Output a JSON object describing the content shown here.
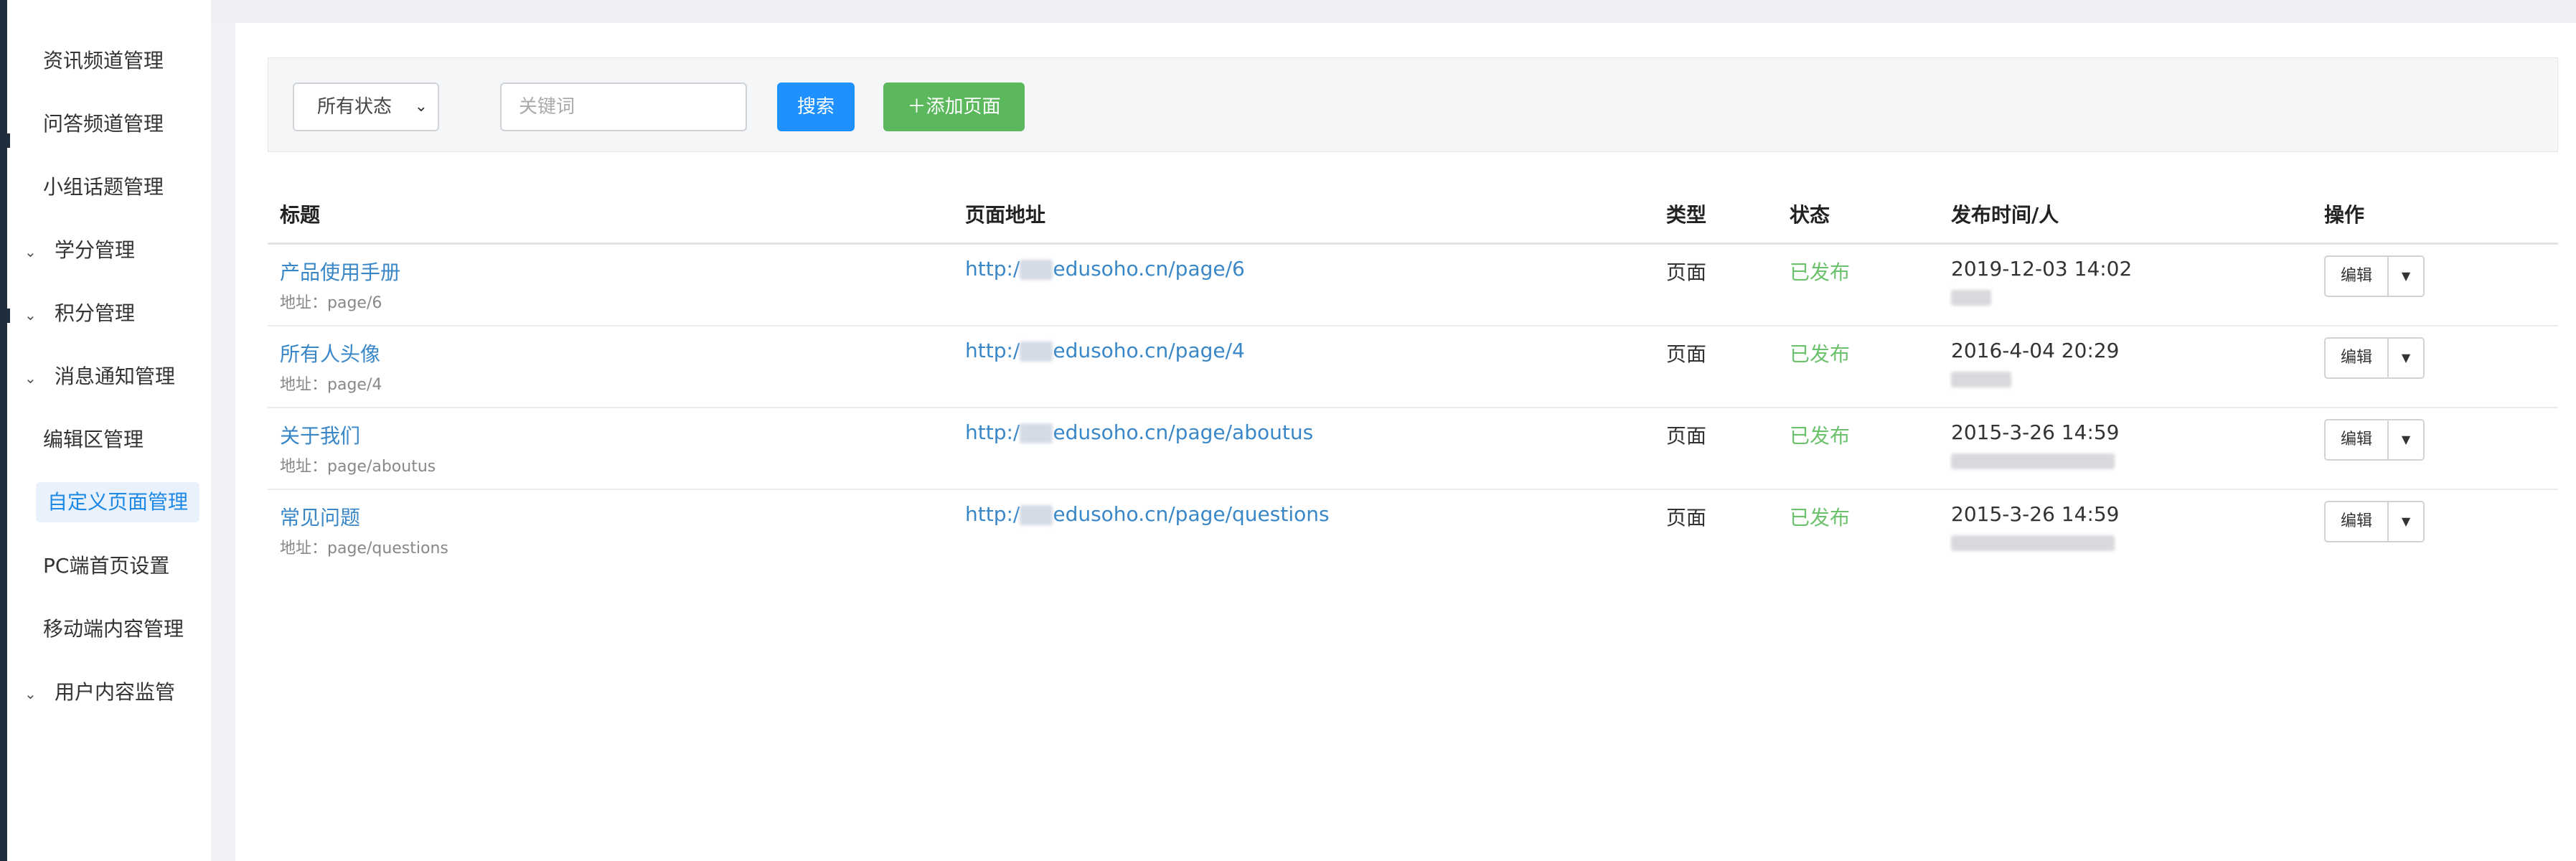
{
  "sidebar": {
    "items": [
      {
        "label": "资讯频道管理",
        "type": "item"
      },
      {
        "label": "问答频道管理",
        "type": "item"
      },
      {
        "label": "小组话题管理",
        "type": "item"
      },
      {
        "label": "学分管理",
        "type": "group"
      },
      {
        "label": "积分管理",
        "type": "group"
      },
      {
        "label": "消息通知管理",
        "type": "group"
      },
      {
        "label": "编辑区管理",
        "type": "item"
      },
      {
        "label": "自定义页面管理",
        "type": "item",
        "active": true
      },
      {
        "label": "PC端首页设置",
        "type": "item"
      },
      {
        "label": "移动端内容管理",
        "type": "item"
      },
      {
        "label": "用户内容监管",
        "type": "group"
      }
    ]
  },
  "filter": {
    "status_select": "所有状态",
    "keyword_placeholder": "关键词",
    "search_label": "搜索",
    "add_label": "＋添加页面"
  },
  "table": {
    "headers": {
      "title": "标题",
      "url": "页面地址",
      "type": "类型",
      "status": "状态",
      "published": "发布时间/人",
      "actions": "操作"
    },
    "rows": [
      {
        "title": "产品使用手册",
        "address": "地址：page/6",
        "url_prefix": "http:/",
        "url_suffix": "edusoho.cn/page/6",
        "type": "页面",
        "status": "已发布",
        "time": "2019-12-03 14:02",
        "edit": "编辑"
      },
      {
        "title": "所有人头像",
        "address": "地址：page/4",
        "url_prefix": "http:/",
        "url_suffix": "edusoho.cn/page/4",
        "type": "页面",
        "status": "已发布",
        "time": "2016-4-04 20:29",
        "edit": "编辑"
      },
      {
        "title": "关于我们",
        "address": "地址：page/aboutus",
        "url_prefix": "http:/",
        "url_suffix": "edusoho.cn/page/aboutus",
        "type": "页面",
        "status": "已发布",
        "time": "2015-3-26 14:59",
        "edit": "编辑"
      },
      {
        "title": "常见问题",
        "address": "地址：page/questions",
        "url_prefix": "http:/",
        "url_suffix": "edusoho.cn/page/questions",
        "type": "页面",
        "status": "已发布",
        "time": "2015-3-26 14:59",
        "edit": "编辑"
      }
    ]
  },
  "colors": {
    "link": "#3a87c8",
    "status_published": "#6cc26c",
    "search_button": "#1e90ff",
    "add_button": "#5cb85c",
    "active_nav_bg": "#e8f1fc"
  }
}
